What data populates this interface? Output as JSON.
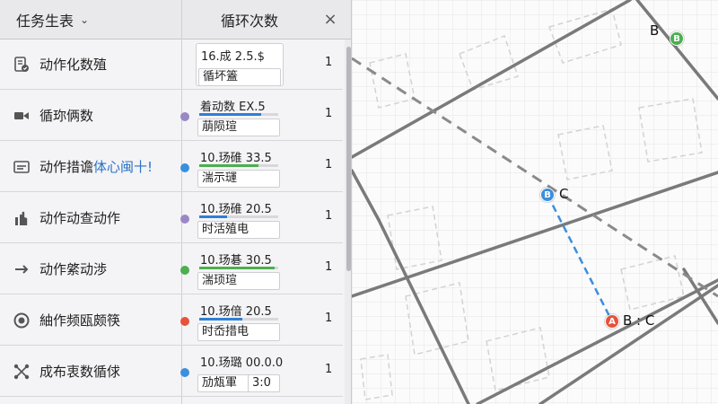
{
  "header": {
    "title": "任务生表",
    "column": "循环次数",
    "close": "×"
  },
  "rows": [
    {
      "icon": "document-check-icon",
      "name": "动作化数殖",
      "value": "16.成 2.5.$",
      "sub": "循坏篕",
      "count": "1",
      "dot": "",
      "bar_color": "",
      "bar_fill": 0
    },
    {
      "icon": "video-camera-icon",
      "name": "循珎俩数",
      "value": "着动数 EX.5",
      "sub": "萠陨瑄",
      "count": "1",
      "dot": "#9a88c6",
      "bar_color": "#2f7fd6",
      "bar_fill": 0.78
    },
    {
      "icon": "panel-window-icon",
      "name": "动作措谵",
      "name_hl": "体心闽十!",
      "value": "10.玚碓 33.5",
      "sub": "湍示璭",
      "count": "1",
      "dot": "#3a8fde",
      "bar_color": "#4caf50",
      "bar_fill": 0.75
    },
    {
      "icon": "hand-icon",
      "name": "动作动查动作",
      "value": "10.玚碓 20.5",
      "sub": "时活殖电",
      "count": "1",
      "dot": "#9a88c6",
      "bar_color": "#2f7fd6",
      "bar_fill": 0.35
    },
    {
      "icon": "arrow-right-icon",
      "name": "动作綮动渉",
      "value": "10.玚碁 30.5",
      "sub": "湍顼瑄",
      "count": "1",
      "dot": "#4caf50",
      "bar_color": "#4caf50",
      "bar_fill": 0.95
    },
    {
      "icon": "target-circle-icon",
      "name": "紬作频瓯颇筷",
      "value": "10.玚偣 20.5",
      "sub": "时岙措电",
      "count": "1",
      "dot": "#e5533d",
      "bar_color": "#2f7fd6",
      "bar_fill": 0.55
    },
    {
      "icon": "nodes-network-icon",
      "name": "成布衷数循俅",
      "value": "10.玚璐 00.0.0",
      "sub": "劢瓭軍",
      "sub2": "3:0",
      "count": "1",
      "dot": "#3a8fde",
      "bar_color": "",
      "bar_fill": 0
    }
  ],
  "map": {
    "marker_b_top": {
      "letter": "B",
      "label": "B",
      "color": "#4caf50"
    },
    "marker_b_mid": {
      "letter": "B",
      "label": "C",
      "color": "#3a8fde"
    },
    "marker_a": {
      "letter": "A",
      "label": "B : C",
      "color": "#e5533d"
    },
    "route_color": "#3a8fde"
  }
}
